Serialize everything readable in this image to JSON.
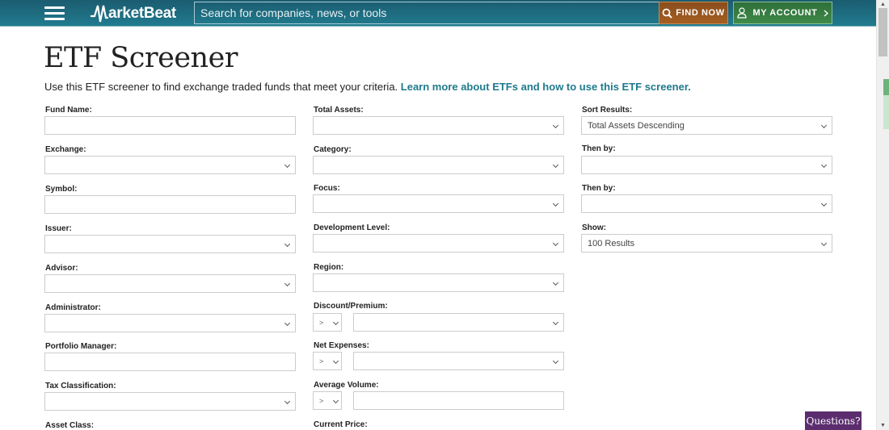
{
  "header": {
    "logo_text": "arketBeat",
    "search_placeholder": "Search for companies, news, or tools",
    "find_now_label": "FIND NOW",
    "my_account_label": "MY ACCOUNT",
    "colors": {
      "header": "#1f6f83",
      "find_now": "#9a5620",
      "my_account": "#377e42",
      "link": "#1e7a8c",
      "questions": "#5b2d6e"
    }
  },
  "page": {
    "title": "ETF Screener",
    "intro_text": "Use this ETF screener to find exchange traded funds that meet your criteria. ",
    "intro_link": "Learn more about ETFs and how to use this ETF screener."
  },
  "form": {
    "col1": [
      {
        "label": "Fund Name:",
        "type": "text",
        "value": ""
      },
      {
        "label": "Exchange:",
        "type": "select",
        "value": ""
      },
      {
        "label": "Symbol:",
        "type": "text",
        "value": ""
      },
      {
        "label": "Issuer:",
        "type": "select",
        "value": ""
      },
      {
        "label": "Advisor:",
        "type": "select",
        "value": ""
      },
      {
        "label": "Administrator:",
        "type": "select",
        "value": ""
      },
      {
        "label": "Portfolio Manager:",
        "type": "text",
        "value": ""
      },
      {
        "label": "Tax Classification:",
        "type": "select",
        "value": ""
      },
      {
        "label": "Asset Class:",
        "type": "select",
        "value": ""
      }
    ],
    "col2": [
      {
        "label": "Total Assets:",
        "type": "select",
        "value": ""
      },
      {
        "label": "Category:",
        "type": "select",
        "value": ""
      },
      {
        "label": "Focus:",
        "type": "select",
        "value": ""
      },
      {
        "label": "Development Level:",
        "type": "select",
        "value": ""
      },
      {
        "label": "Region:",
        "type": "select",
        "value": ""
      },
      {
        "label": "Discount/Premium:",
        "type": "op-select",
        "operator": ">",
        "value": ""
      },
      {
        "label": "Net Expenses:",
        "type": "op-select",
        "operator": ">",
        "value": ""
      },
      {
        "label": "Average Volume:",
        "type": "op-text",
        "operator": ">",
        "value": ""
      },
      {
        "label": "Current Price:",
        "type": "op-text",
        "operator": ">",
        "value": ""
      }
    ],
    "col3": [
      {
        "label": "Sort Results:",
        "type": "select",
        "value": "Total Assets Descending"
      },
      {
        "label": "Then by:",
        "type": "select",
        "value": ""
      },
      {
        "label": "Then by:",
        "type": "select",
        "value": ""
      },
      {
        "label": "Show:",
        "type": "select",
        "value": "100 Results"
      }
    ]
  },
  "widgets": {
    "questions_label": "Questions?"
  }
}
